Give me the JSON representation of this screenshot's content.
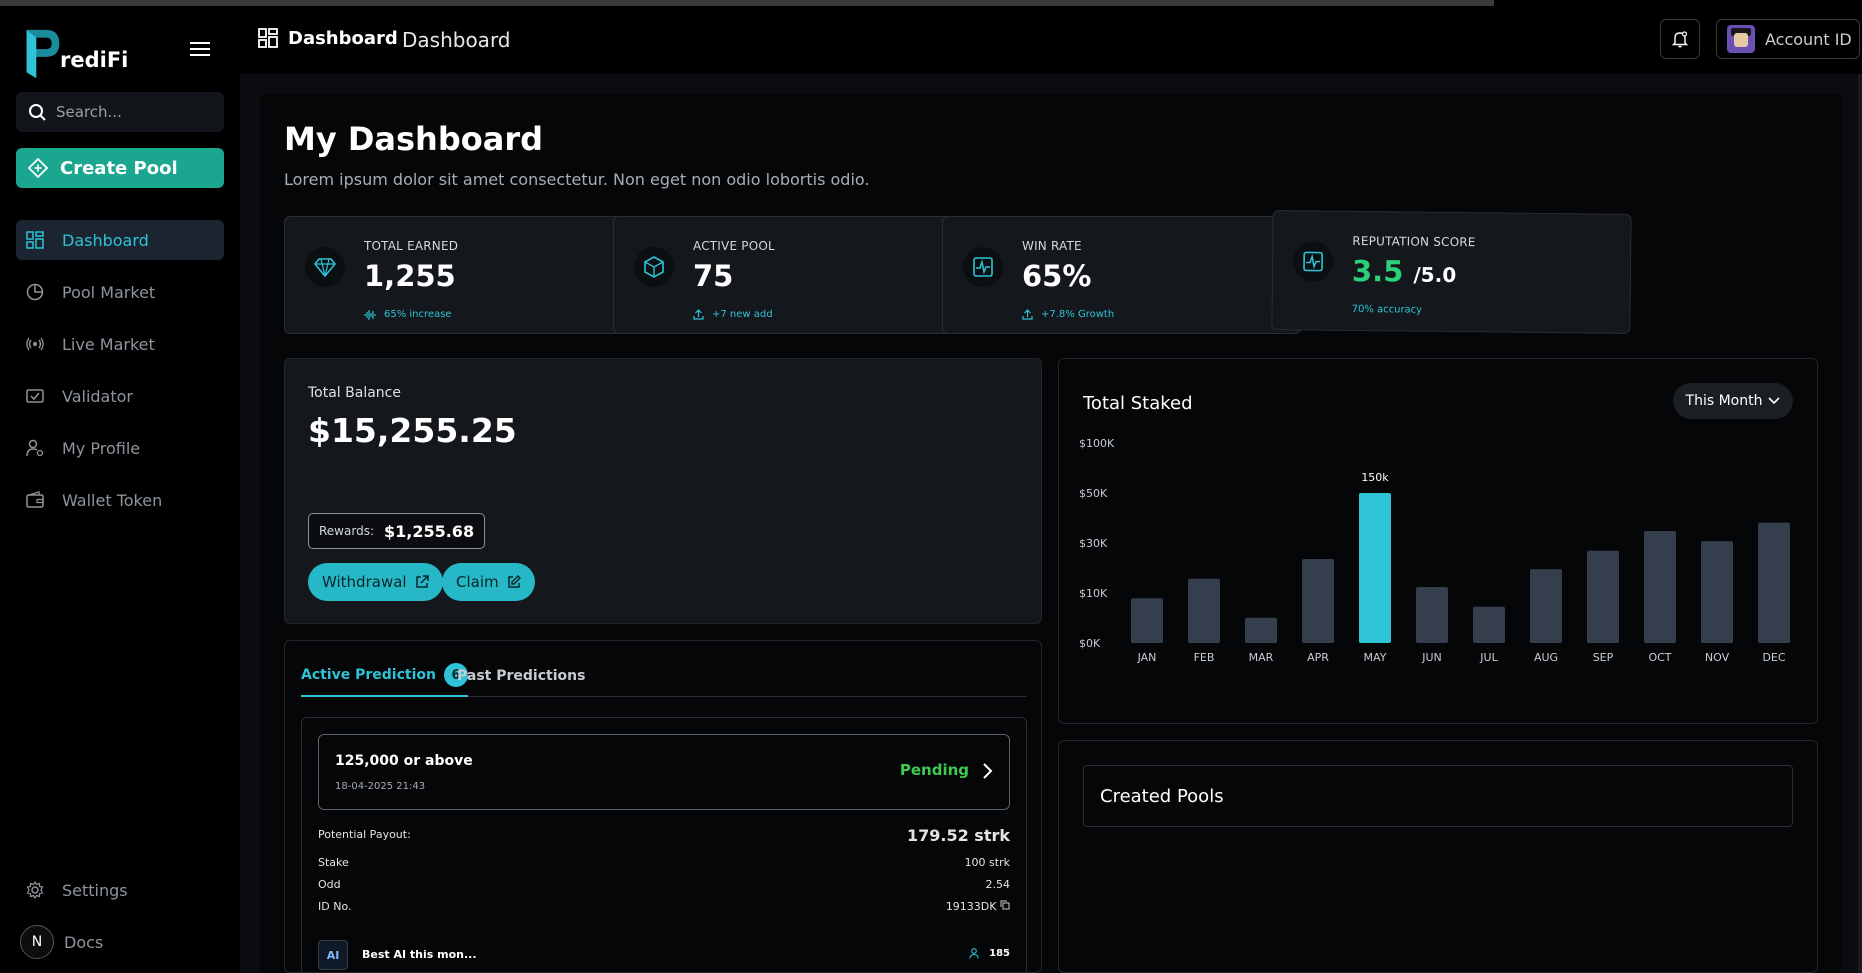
{
  "app": {
    "name": "rediFi",
    "logo_letter": "P"
  },
  "sidebar": {
    "search_placeholder": "Search...",
    "create_label": "Create Pool",
    "items": [
      {
        "label": "Dashboard",
        "icon": "dashboard-icon",
        "active": true
      },
      {
        "label": "Pool Market",
        "icon": "pie-chart-icon",
        "active": false
      },
      {
        "label": "Live Market",
        "icon": "broadcast-icon",
        "active": false
      },
      {
        "label": "Validator",
        "icon": "ticket-check-icon",
        "active": false
      },
      {
        "label": "My Profile",
        "icon": "user-gear-icon",
        "active": false
      },
      {
        "label": "Wallet Token",
        "icon": "wallet-icon",
        "active": false
      }
    ],
    "bottom": [
      {
        "label": "Settings",
        "icon": "gear-icon"
      },
      {
        "label": "Docs",
        "icon": "docs-n-icon",
        "circle_letter": "N"
      }
    ]
  },
  "header": {
    "crumb_primary": "Dashboard",
    "crumb_secondary": "Dashboard",
    "account_label": "Account ID"
  },
  "page": {
    "title": "My Dashboard",
    "subtitle": "Lorem ipsum dolor sit amet consectetur. Non eget non odio lobortis odio."
  },
  "stats": [
    {
      "label": "TOTAL EARNED",
      "value": "1,255",
      "sub": "65% increase",
      "icon": "diamond-icon"
    },
    {
      "label": "ACTIVE POOL",
      "value": "75",
      "sub": "+7 new add",
      "icon": "cube-icon"
    },
    {
      "label": "WIN RATE",
      "value": "65%",
      "sub": "+7.8% Growth",
      "icon": "activity-icon"
    },
    {
      "label": "REPUTATION SCORE",
      "value": "3.5",
      "denom": "/5.0",
      "sub": "70% accuracy",
      "icon": "activity-icon"
    }
  ],
  "balance": {
    "label": "Total Balance",
    "value": "$15,255.25",
    "rewards_label": "Rewards:",
    "rewards_value": "$1,255.68",
    "withdraw_label": "Withdrawal",
    "claim_label": "Claim"
  },
  "predictions": {
    "tab_active": "Active Prediction",
    "tab_active_count": "6",
    "tab_past": "Past Predictions",
    "card": {
      "title": "125,000 or above",
      "date": "18-04-2025 21:43",
      "status": "Pending",
      "payout_label": "Potential Payout:",
      "payout_value": "179.52 strk",
      "stake_label": "Stake",
      "stake_value": "100 strk",
      "odd_label": "Odd",
      "odd_value": "2.54",
      "id_label": "ID No.",
      "id_value": "19133DK",
      "ai_badge": "AI",
      "ai_title": "Best AI this mon...",
      "participants": "185"
    }
  },
  "staked": {
    "title": "Total Staked",
    "period": "This Month",
    "highlight_label": "150k"
  },
  "created_pools": {
    "title": "Created Pools"
  },
  "colors": {
    "accent": "#2ec3d6",
    "brand_green": "#1aa68f",
    "bar": "#353e4d",
    "bar_highlight": "#2ec3d6",
    "pending": "#3ecb4f",
    "score": "#2bd17a"
  },
  "chart_data": {
    "type": "bar",
    "title": "Total Staked",
    "categories": [
      "JAN",
      "FEB",
      "MAR",
      "APR",
      "MAY",
      "JUN",
      "JUL",
      "AUG",
      "SEP",
      "OCT",
      "NOV",
      "DEC"
    ],
    "y_ticks": [
      "$0K",
      "$10K",
      "$30K",
      "$50K",
      "$100K"
    ],
    "values": [
      8,
      11.5,
      4.5,
      15,
      25,
      10,
      6.5,
      13.2,
      16.5,
      20,
      18.2,
      21.5
    ],
    "highlight_index": 4,
    "highlight_label": "150k",
    "grid": false,
    "legend": "none"
  }
}
